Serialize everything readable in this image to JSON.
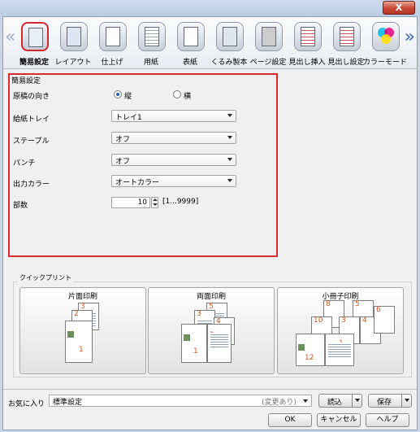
{
  "window_title": "",
  "toolbar": {
    "items": [
      {
        "label": "簡易設定",
        "icon": "quick-settings-icon"
      },
      {
        "label": "レイアウト",
        "icon": "layout-icon"
      },
      {
        "label": "仕上げ",
        "icon": "finishing-icon"
      },
      {
        "label": "用紙",
        "icon": "paper-icon"
      },
      {
        "label": "表紙",
        "icon": "cover-icon"
      },
      {
        "label": "くるみ製本",
        "icon": "perfect-binding-icon"
      },
      {
        "label": "ページ設定",
        "icon": "page-settings-icon"
      },
      {
        "label": "見出し挿入",
        "icon": "tab-insert-icon"
      },
      {
        "label": "見出し設定",
        "icon": "tab-settings-icon"
      },
      {
        "label": "カラーモード",
        "icon": "color-mode-icon"
      }
    ]
  },
  "simple_settings": {
    "title": "簡易設定",
    "orientation": {
      "label": "原稿の向き",
      "portrait": "縦",
      "landscape": "横",
      "selected": "縦"
    },
    "tray": {
      "label": "給紙トレイ",
      "value": "トレイ1"
    },
    "staple": {
      "label": "ステープル",
      "value": "オフ"
    },
    "punch": {
      "label": "パンチ",
      "value": "オフ"
    },
    "color": {
      "label": "出力カラー",
      "value": "オートカラー"
    },
    "copies": {
      "label": "部数",
      "value": "10",
      "range": "[1...9999]"
    }
  },
  "quick_print": {
    "title": "クイックプリント",
    "buttons": [
      {
        "label": "片面印刷",
        "pages": [
          "3",
          "2",
          "1"
        ]
      },
      {
        "label": "両面印刷",
        "pages": [
          "5",
          "3",
          "4",
          "1",
          "2"
        ]
      },
      {
        "label": "小冊子印刷",
        "pages": [
          "8",
          "5",
          "10",
          "3",
          "4",
          "6",
          "12",
          "1"
        ]
      }
    ]
  },
  "bottom": {
    "favorites_label": "お気に入り",
    "favorites_value": "標準設定",
    "favorites_note": "(変更あり)",
    "load_label": "読込",
    "save_label": "保存",
    "ok_label": "OK",
    "cancel_label": "キャンセル",
    "help_label": "ヘルプ"
  },
  "title_close": "X"
}
